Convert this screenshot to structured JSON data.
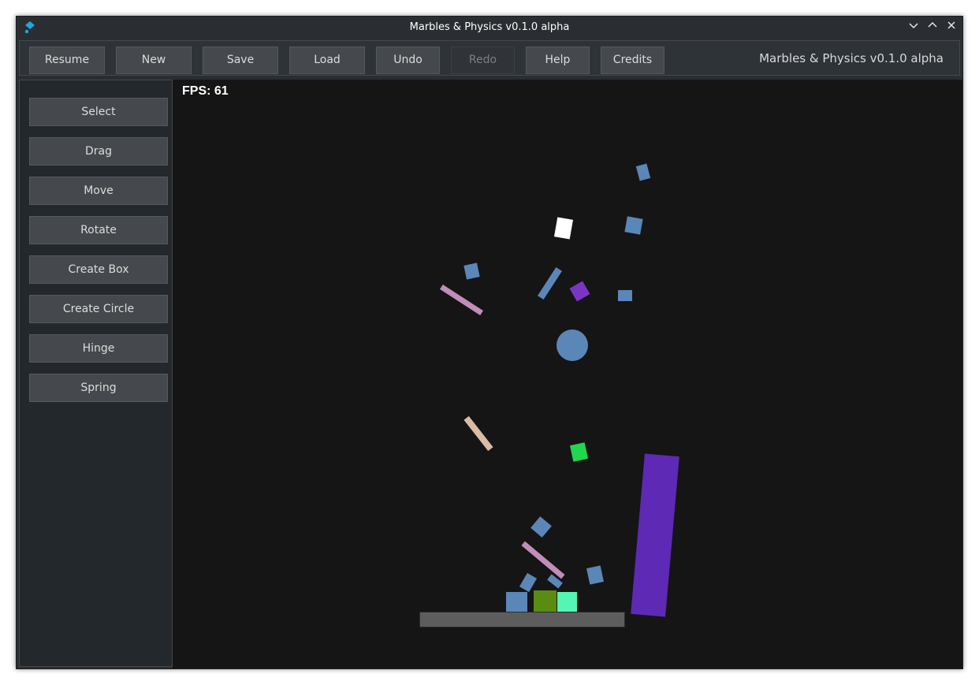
{
  "window": {
    "title": "Marbles & Physics v0.1.0 alpha",
    "controls": [
      "minimize",
      "maximize",
      "close"
    ]
  },
  "toolbar": {
    "buttons": [
      {
        "label": "Resume",
        "enabled": true
      },
      {
        "label": "New",
        "enabled": true
      },
      {
        "label": "Save",
        "enabled": true
      },
      {
        "label": "Load",
        "enabled": true
      },
      {
        "label": "Undo",
        "enabled": true
      },
      {
        "label": "Redo",
        "enabled": false
      },
      {
        "label": "Help",
        "enabled": true
      },
      {
        "label": "Credits",
        "enabled": true
      }
    ],
    "title": "Marbles & Physics v0.1.0 alpha"
  },
  "sidebar": {
    "tools": [
      "Select",
      "Drag",
      "Move",
      "Rotate",
      "Create Box",
      "Create Circle",
      "Hinge",
      "Spring"
    ]
  },
  "scene": {
    "fps_text": "FPS: 61",
    "colors": {
      "background": "#151515",
      "steel_blue": "#5b86b8",
      "white": "#ffffff",
      "purple": "#7b35c4",
      "dark_purple": "#5e29b5",
      "pink": "#c28db8",
      "tan": "#d8bca6",
      "green": "#1fd84f",
      "olive": "#5a8c12",
      "mint": "#55f5b5",
      "ground": "#5d5d5d"
    }
  }
}
